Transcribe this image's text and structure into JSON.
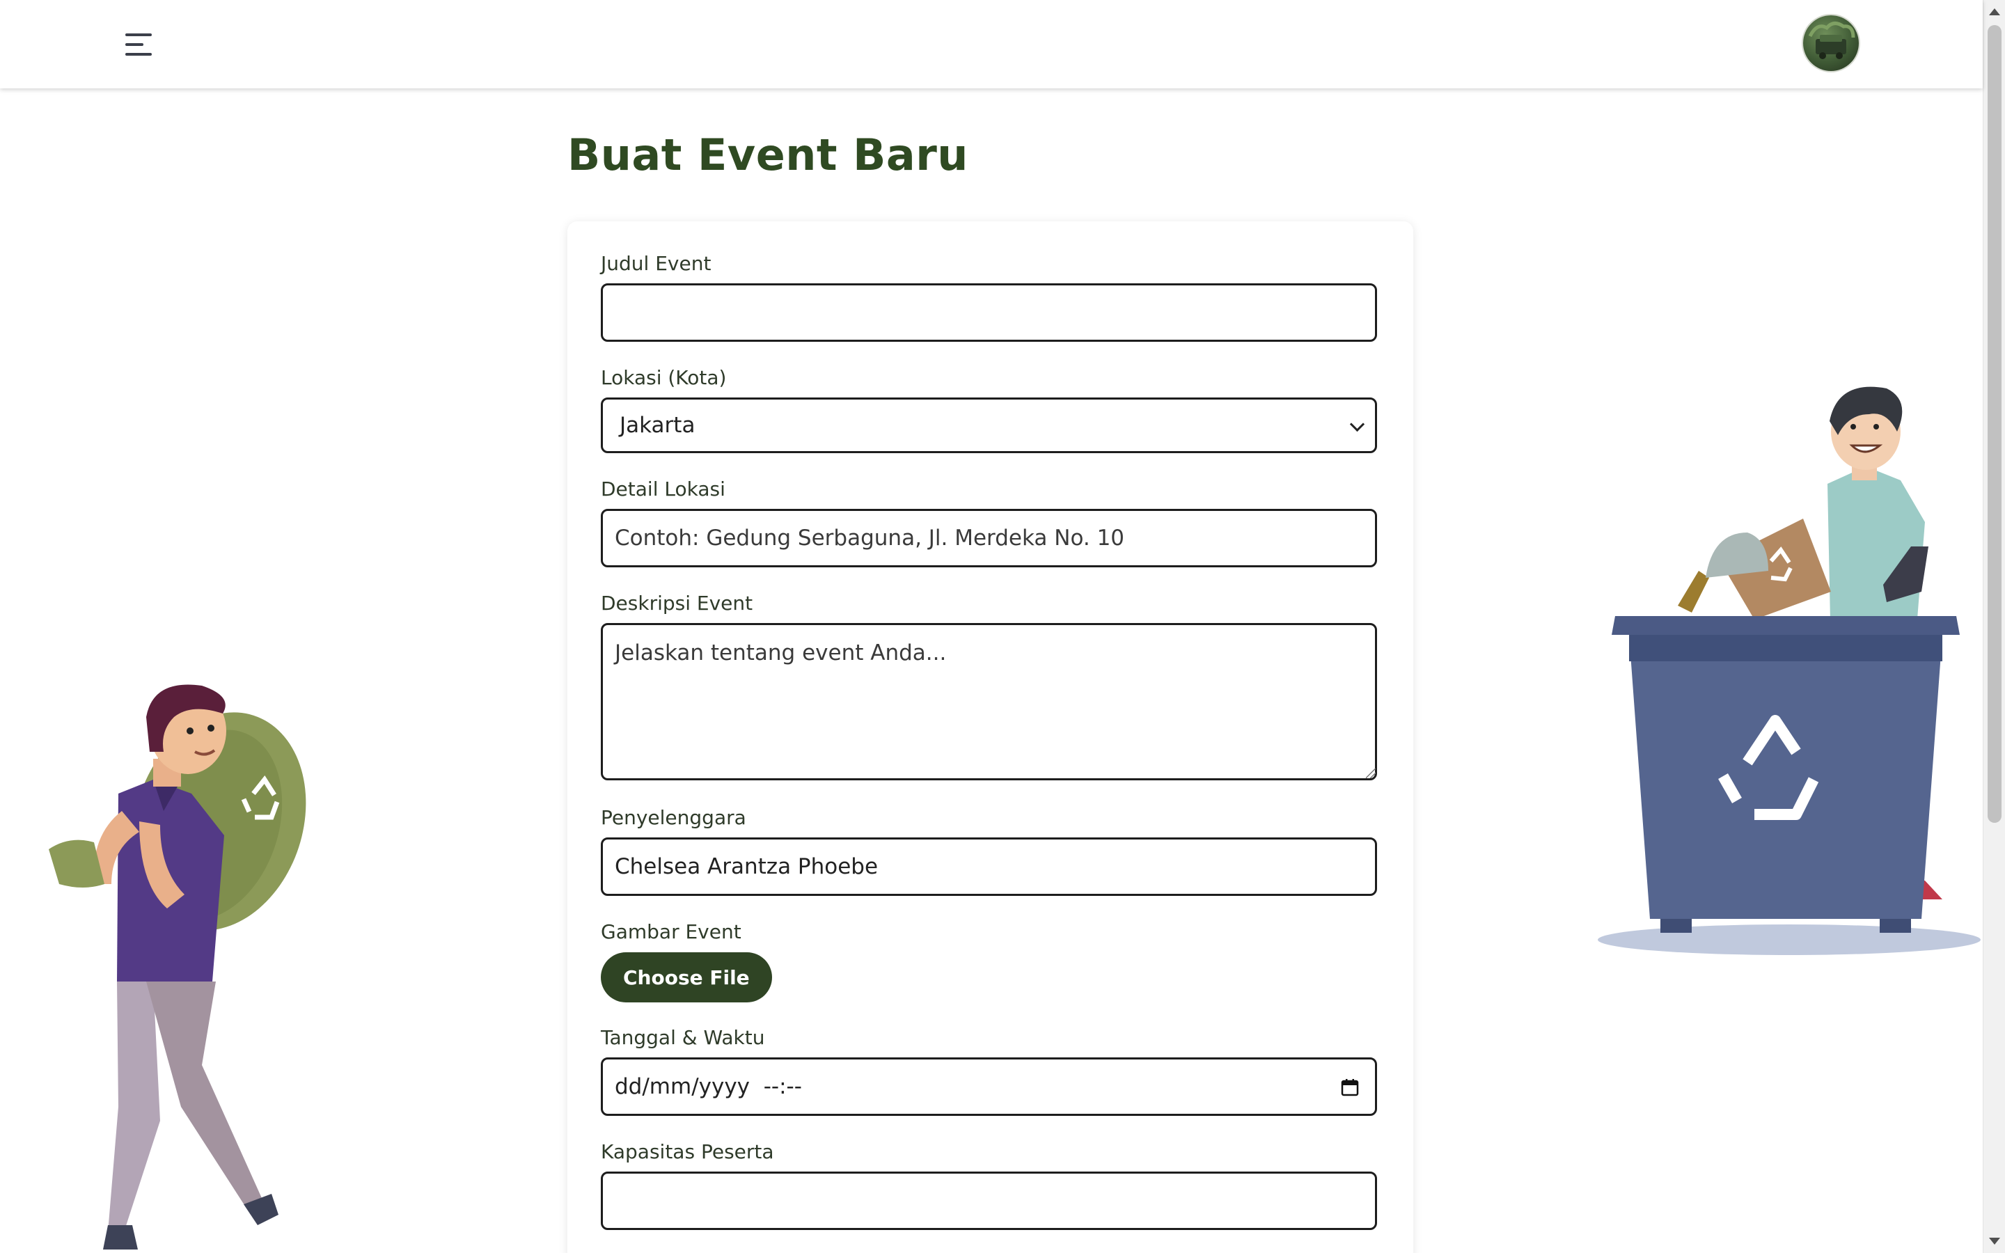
{
  "header": {
    "menu_icon": "hamburger-menu-icon",
    "avatar_icon": "user-avatar"
  },
  "page": {
    "title": "Buat Event Baru"
  },
  "form": {
    "judul": {
      "label": "Judul Event",
      "value": ""
    },
    "lokasi": {
      "label": "Lokasi (Kota)",
      "selected": "Jakarta"
    },
    "detail": {
      "label": "Detail Lokasi",
      "placeholder": "Contoh: Gedung Serbaguna, Jl. Merdeka No. 10"
    },
    "deskripsi": {
      "label": "Deskripsi Event",
      "placeholder": "Jelaskan tentang event Anda..."
    },
    "penyelenggara": {
      "label": "Penyelenggara",
      "value": "Chelsea Arantza Phoebe"
    },
    "gambar": {
      "label": "Gambar Event",
      "button": "Choose File"
    },
    "tanggal": {
      "label": "Tanggal & Waktu",
      "placeholder": "dd/mm/yyyy  --:--"
    },
    "kapasitas": {
      "label": "Kapasitas Peserta",
      "value": ""
    }
  },
  "colors": {
    "title": "#2f4a22",
    "button": "#2f4424",
    "bin": "#55658f",
    "bag": "#8c9a58",
    "shirt_left": "#533a86",
    "shirt_right": "#9ccbc6"
  },
  "illustrations": {
    "left": "man-carrying-recycle-bag",
    "right": "man-recycling-into-bin"
  }
}
